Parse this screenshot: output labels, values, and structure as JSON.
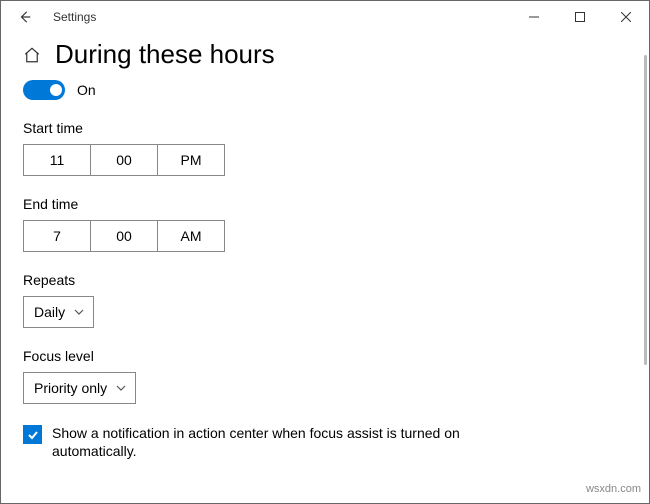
{
  "window": {
    "title": "Settings"
  },
  "page": {
    "heading": "During these hours"
  },
  "toggle": {
    "state": "on",
    "label": "On"
  },
  "sections": {
    "start": {
      "label": "Start time",
      "hour": "11",
      "minute": "00",
      "meridiem": "PM"
    },
    "end": {
      "label": "End time",
      "hour": "7",
      "minute": "00",
      "meridiem": "AM"
    },
    "repeats": {
      "label": "Repeats",
      "value": "Daily"
    },
    "focus": {
      "label": "Focus level",
      "value": "Priority only"
    }
  },
  "checkbox": {
    "checked": true,
    "text": "Show a notification in action center when focus assist is turned on automatically."
  },
  "watermark": "wsxdn.com"
}
